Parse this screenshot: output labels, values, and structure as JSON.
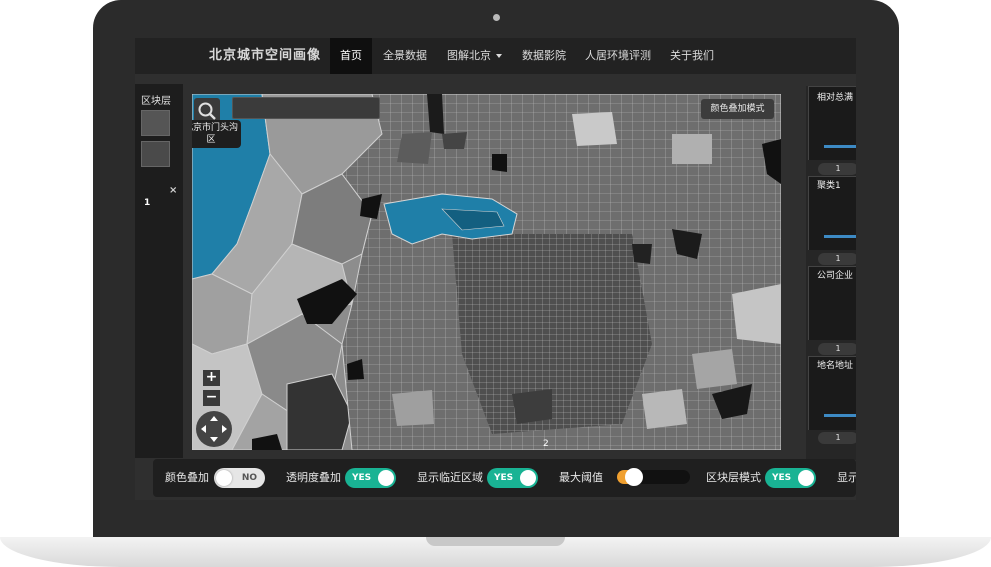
{
  "navbar": {
    "brand": "北京城市空间画像",
    "items": [
      {
        "label": "首页",
        "active": true
      },
      {
        "label": "全景数据",
        "active": false
      },
      {
        "label": "图解北京",
        "active": false,
        "dropdown": true
      },
      {
        "label": "数据影院",
        "active": false
      },
      {
        "label": "人居环境评测",
        "active": false
      },
      {
        "label": "关于我们",
        "active": false
      }
    ]
  },
  "left_panel": {
    "title": "区块层",
    "layers": [
      {
        "label": ""
      },
      {
        "label": "1"
      }
    ],
    "close_glyph": "×"
  },
  "map": {
    "search_placeholder": "",
    "tooltip": "北京市门头沟区",
    "color_mode_button": "颜色叠加模式",
    "zoom_in": "+",
    "zoom_out": "−",
    "bottom_number": "2",
    "highlight_color": "#1f7fa8",
    "icons": {
      "search": "search-icon",
      "pan": "pan-arrows-icon"
    }
  },
  "right_panel": {
    "cards": [
      {
        "title": "相对总满",
        "count": "1"
      },
      {
        "title": "聚类1",
        "count": "1"
      },
      {
        "title": "公司企业",
        "count": "1"
      },
      {
        "title": "地名地址",
        "count": "1"
      }
    ],
    "bar_color": "#3d8ac4"
  },
  "toolbar": {
    "items": [
      {
        "label": "颜色叠加",
        "type": "toggle",
        "state": "NO"
      },
      {
        "label": "透明度叠加",
        "type": "toggle",
        "state": "YES"
      },
      {
        "label": "显示临近区域",
        "type": "toggle",
        "state": "YES"
      },
      {
        "label": "最大阈值",
        "type": "slider",
        "value": 0.15
      },
      {
        "label": "区块层模式",
        "type": "toggle",
        "state": "YES"
      },
      {
        "label": "显示",
        "type": "label"
      }
    ],
    "accent_on": "#19b394",
    "slider_color": "#f0a030"
  }
}
